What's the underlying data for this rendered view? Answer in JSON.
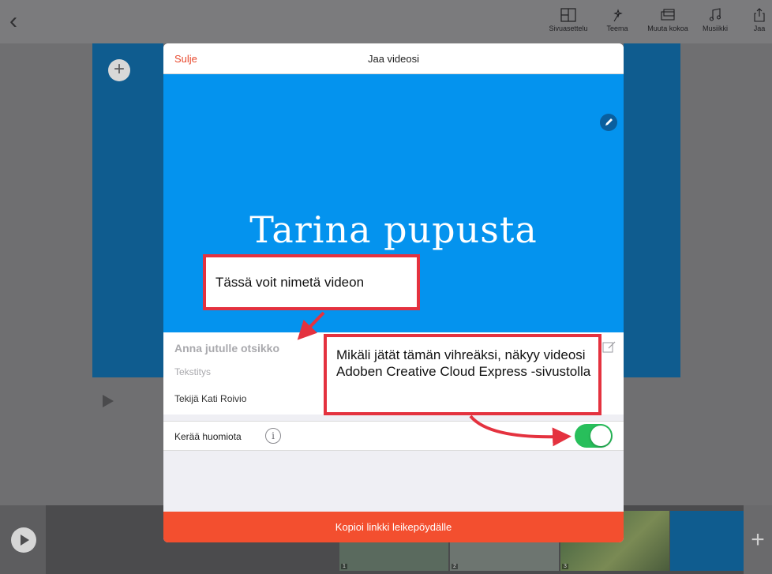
{
  "toolbar": {
    "back_icon": "chevron-left-icon",
    "items": [
      {
        "label": "Sivuasettelu",
        "icon": "layout-icon"
      },
      {
        "label": "Teema",
        "icon": "magic-icon"
      },
      {
        "label": "Muuta kokoa",
        "icon": "resize-icon"
      },
      {
        "label": "Musiikki",
        "icon": "music-icon"
      },
      {
        "label": "Jaa",
        "icon": "share-icon"
      }
    ]
  },
  "modal": {
    "close_label": "Sulje",
    "title": "Jaa videosi",
    "preview_title": "Tarina pupusta",
    "title_placeholder": "Anna jutulle otsikko",
    "subtitle_placeholder": "Tekstitys",
    "author": "Tekijä Kati Roivio",
    "attention_label": "Kerää huomiota",
    "attention_enabled": true,
    "copy_button": "Kopioi linkki leikepöydälle"
  },
  "thumbnails": [
    {
      "num": "1"
    },
    {
      "num": "2"
    },
    {
      "num": "3"
    },
    {
      "num": ""
    }
  ],
  "annotations": {
    "callout_1": "Tässä voit nimetä videon",
    "callout_2": "Mikäli jätät tämän vihreäksi, näkyy videosi Adoben Creative Cloud Express -sivustolla"
  },
  "colors": {
    "accent": "#f34f2f",
    "preview_bg": "#0493ee",
    "toggle_on": "#28bf5b",
    "annotation_border": "#e4323f"
  }
}
